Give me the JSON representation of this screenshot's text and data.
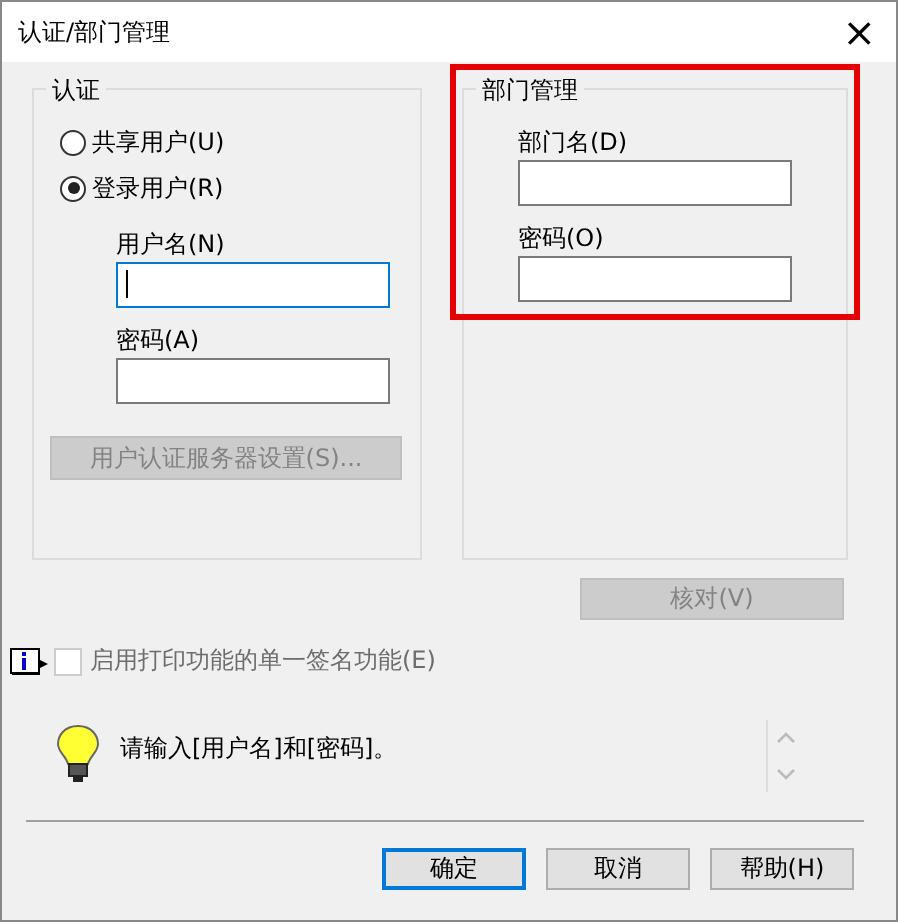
{
  "window": {
    "title": "认证/部门管理",
    "close": "×"
  },
  "auth": {
    "legend": "认证",
    "options": [
      {
        "label": "共享用户(U)",
        "selected": false
      },
      {
        "label": "登录用户(R)",
        "selected": true
      }
    ],
    "username": {
      "label": "用户名(N)",
      "focused": true
    },
    "password": {
      "label": "密码(A)",
      "focused": false
    },
    "server_button": {
      "label": "用户认证服务器设置(S)...",
      "disabled": true
    }
  },
  "department": {
    "legend": "部门管理",
    "highlighted": true,
    "name": {
      "label": "部门名(D)"
    },
    "password": {
      "label": "密码(O)"
    }
  },
  "verify_button": {
    "label": "核对(V)",
    "disabled": true
  },
  "sso": {
    "label": "启用打印功能的单一签名功能(E)",
    "checked": false,
    "disabled": true
  },
  "message": "请输入[用户名]和[密码]。",
  "buttons": [
    {
      "label": "确定",
      "default": true
    },
    {
      "label": "取消",
      "default": false
    },
    {
      "label": "帮助(H)",
      "default": false
    }
  ]
}
